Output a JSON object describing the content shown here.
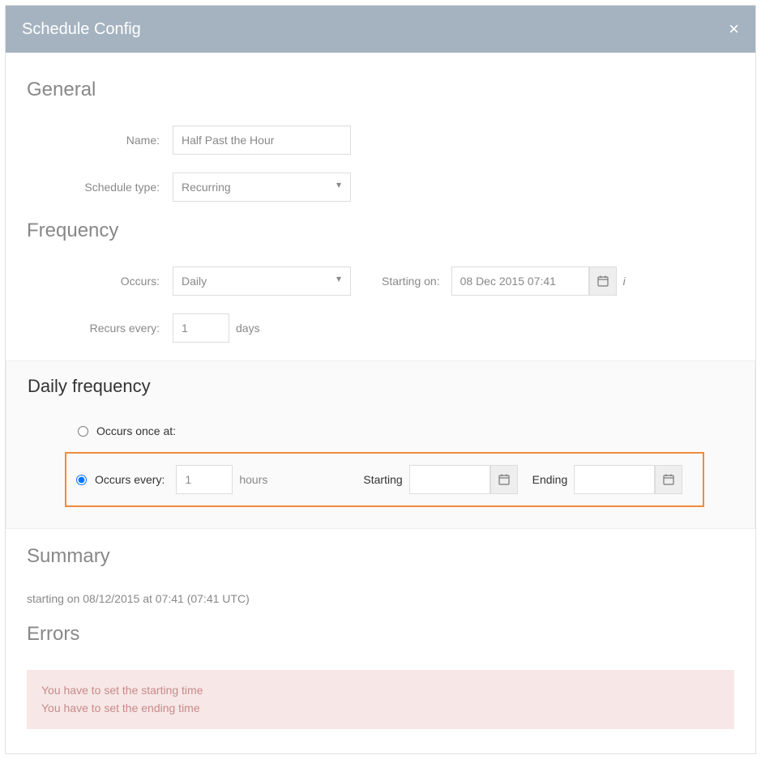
{
  "modal": {
    "title": "Schedule Config",
    "close": "×"
  },
  "sections": {
    "general": "General",
    "frequency": "Frequency",
    "daily_frequency": "Daily frequency",
    "summary": "Summary",
    "errors": "Errors"
  },
  "labels": {
    "name": "Name:",
    "schedule_type": "Schedule type:",
    "occurs": "Occurs:",
    "starting_on": "Starting on:",
    "recurs_every": "Recurs every:",
    "days_suffix": "days",
    "occurs_once_at": "Occurs once at:",
    "occurs_every": "Occurs every:",
    "hours_suffix": "hours",
    "starting": "Starting",
    "ending": "Ending"
  },
  "values": {
    "name": "Half Past the Hour",
    "schedule_type": "Recurring",
    "occurs": "Daily",
    "starting_on": "08 Dec 2015 07:41",
    "recurs_every": "1",
    "occurs_every_value": "1",
    "starting_time": "",
    "ending_time": ""
  },
  "radio": {
    "occurs_once_checked": false,
    "occurs_every_checked": true
  },
  "summary": {
    "text": "starting on 08/12/2015 at 07:41 (07:41 UTC)"
  },
  "errors": {
    "line1": "You have to set the starting time",
    "line2": "You have to set the ending time"
  },
  "icons": {
    "info": "i"
  }
}
